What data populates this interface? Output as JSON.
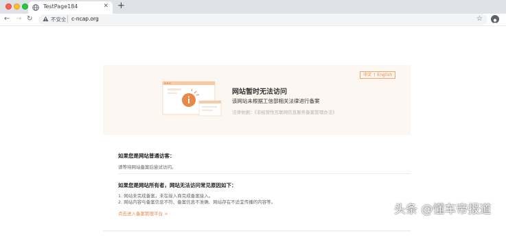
{
  "browser": {
    "tab_title": "TestPage184",
    "new_tab": "+",
    "insecure_label": "不安全",
    "url": "c-ncap.org"
  },
  "banner": {
    "lang_zh": "中文",
    "lang_sep": "|",
    "lang_en": "English",
    "title": "网站暂时无法访问",
    "subtitle": "该网站未根据工信部相关法律进行备案",
    "law": "法律依据：《非经营性互联网信息服务备案管理办法》",
    "illustration_icon": "info-icon"
  },
  "visitor": {
    "heading": "如果您是网站普通访客：",
    "text": "请等待网站备案后尝试访问。"
  },
  "owner": {
    "heading": "如果您是网站所有者，网站无法访问常见原因如下：",
    "reason1": "1. 网站未完成备案，未在接入商完成备案接入。",
    "reason2": "2. 网站内容与备案信息不符、备案信息不准确、网站存在不适宜传播的内容等。",
    "link": "点击进入备案管理平台 >"
  },
  "watermark": "头条 @懂车帝报道",
  "colors": {
    "accent": "#e8874a",
    "banner_bg": "#fdf7f2"
  }
}
